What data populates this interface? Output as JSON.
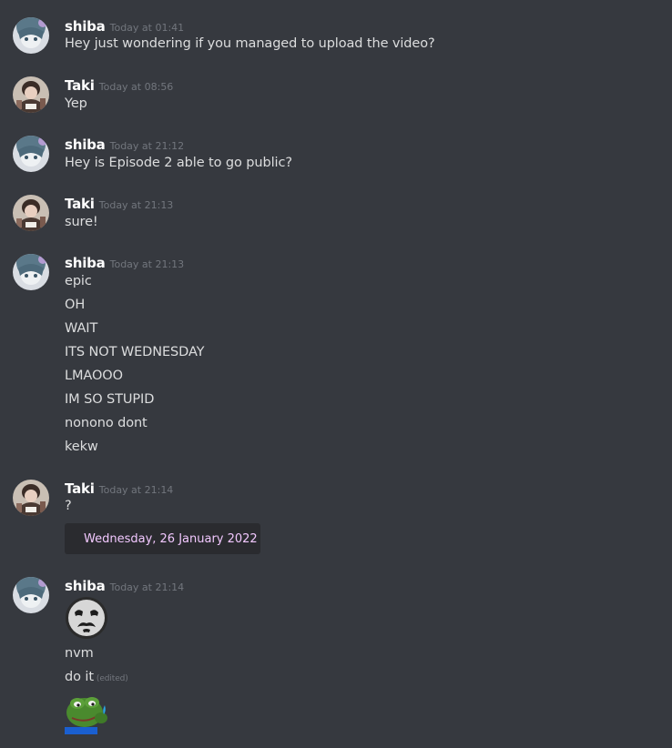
{
  "messages": [
    {
      "author": "shiba",
      "timestamp": "Today at 01:41",
      "lines": [
        "Hey just wondering if you managed to upload the video?"
      ]
    },
    {
      "author": "Taki",
      "timestamp": "Today at 08:56",
      "lines": [
        "Yep"
      ]
    },
    {
      "author": "shiba",
      "timestamp": "Today at 21:12",
      "lines": [
        "Hey is Episode 2 able to go public?"
      ]
    },
    {
      "author": "Taki",
      "timestamp": "Today at 21:13",
      "lines": [
        "sure!"
      ]
    },
    {
      "author": "shiba",
      "timestamp": "Today at 21:13",
      "lines": [
        "epic",
        "OH",
        "WAIT",
        "ITS NOT WEDNESDAY",
        "LMAOOO",
        "IM SO STUPID",
        "nonono dont",
        "kekw"
      ]
    },
    {
      "author": "Taki",
      "timestamp": "Today at 21:14",
      "lines": [
        "?"
      ],
      "date_box": "Wednesday, 26 January 2022"
    },
    {
      "author": "shiba",
      "timestamp": "Today at 21:14",
      "emoji_top": "sad-face-emoji",
      "lines": [
        "nvm",
        "do it"
      ],
      "edited_label": "(edited)",
      "emoji_bottom": "pepe-frog-emoji"
    }
  ],
  "colors": {
    "background": "#36393f",
    "username": "#ffffff",
    "text": "#dcddde",
    "timestamp": "#72767d",
    "date_box_text": "#f2c8ff"
  }
}
